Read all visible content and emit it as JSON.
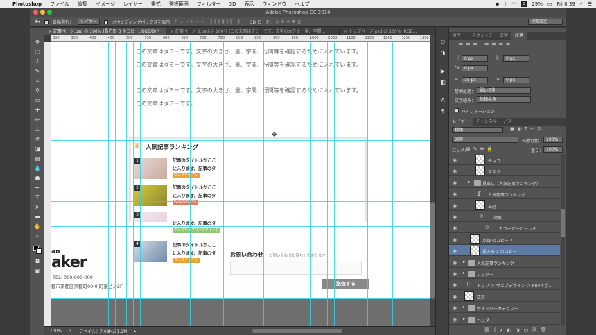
{
  "menubar": {
    "apple": "",
    "app": "Photoshop",
    "items": [
      "ファイル",
      "編集",
      "イメージ",
      "レイヤー",
      "書式",
      "選択範囲",
      "フィルター",
      "3D",
      "表示",
      "ウィンドウ",
      "ヘルプ"
    ],
    "battery": "29%",
    "badge": "A",
    "clock": "Fri 8:39"
  },
  "window": {
    "title": "Adobe Photoshop CC 2014"
  },
  "options": {
    "auto_select_label": "自動選択：",
    "auto_select_value": "レイヤー",
    "bbox_label": "バウンディングボックスを表示",
    "mode3d": "3D モード:",
    "workspace": "初期設定"
  },
  "tabs": [
    {
      "label": "記事ページ.psd @ 100% (長方形 3 のコピー, RGB/8) *",
      "active": true
    },
    {
      "label": "記事ページ 2.psd @ 100% (この文章はダミーです。文字の大きさ、量、字間…",
      "active": false
    },
    {
      "label": "トップページ.psd @ 100% (RGB…",
      "active": false
    }
  ],
  "ruler_ticks": [
    "300",
    "350",
    "400",
    "450",
    "500",
    "550",
    "600",
    "650",
    "700",
    "750",
    "800",
    "850",
    "900",
    "950",
    "1000",
    "1050",
    "1100",
    "1150",
    "1200",
    "1250",
    "1300"
  ],
  "canvas": {
    "para1": "この文章はダミーです。文字の大きさ、量、字間、行間等を確認するために入れています。この文章はダミーです。文字の大きさ、量、字間、行間等を確認するために入れています。",
    "para2": "この文章はダミーです。文字の大きさ、量、字間、行間等を確認するために入れています。この文章はダミーです。",
    "ranking_title": "人気記事ランキング",
    "ranking": [
      {
        "num": "1",
        "title": "記事のタイトルがここ",
        "title2": "に入ります。記事のタ",
        "tag": "ウェブデザイン",
        "tag_color": "#f0a030"
      },
      {
        "num": "2",
        "title": "記事のタイトルがここ",
        "title2": "に入ります。記事のタ",
        "tag": "WORDPRESS",
        "tag_color": "#e07c5a"
      },
      {
        "num": "3",
        "title": "",
        "title2": "に入ります。記事のタ",
        "tag": "ウェブウェブマーケティング",
        "tag_color": "#8cc870"
      },
      {
        "num": "4",
        "title": "記事のタイトルがここ",
        "title2": "に入ります。記事のタ",
        "tag": "ウェブデザイン",
        "tag_color": "#f0a030"
      }
    ],
    "logo_top": "an",
    "logo": "aker",
    "tel": "TEL: 000-000-000",
    "address": "都市京都区京都町00-0 町家ビル2F",
    "contact_title": "お問い合わせ",
    "contact_sub": "お問い合わせお待ちしております",
    "submit": "送信する"
  },
  "status": {
    "zoom": "100%",
    "file": "ファイル：7.08M/31.2M"
  },
  "panels": {
    "char_tabs": [
      "カラー",
      "スウォッチ",
      "文字",
      "段落"
    ],
    "char_active": "段落",
    "indent1": "0 px",
    "indent2": "0 px",
    "indent3": "0 px",
    "space1": "15 px",
    "space2": "0 px",
    "kinsoku_label": "禁則処理：",
    "kinsoku_value": "弱い禁則",
    "mojikumi_label": "文字組み：",
    "mojikumi_value": "約物半角",
    "hyphen_label": "ハイフネーション",
    "layer_tabs": [
      "レイヤー",
      "チャンネル",
      "パス"
    ],
    "layer_active": "レイヤー",
    "filter_kind": "種類",
    "blend": "通常",
    "opacity_label": "不透明度：",
    "opacity": "100%",
    "lock_label": "ロック：",
    "fill_label": "塗り：",
    "fill": "100%",
    "layers": [
      {
        "name": "チョコ",
        "kind": "pixel",
        "indent": 2,
        "selected": false
      },
      {
        "name": "マスク",
        "kind": "pixel",
        "indent": 2,
        "selected": false
      },
      {
        "name": "見出し（人気記事ランキング）",
        "kind": "group",
        "indent": 1,
        "selected": false
      },
      {
        "name": "人気記事ランキング",
        "kind": "text",
        "indent": 2,
        "selected": false
      },
      {
        "name": "王冠",
        "kind": "pixel",
        "indent": 2,
        "selected": false
      },
      {
        "name": "効果",
        "kind": "fx",
        "indent": 3,
        "selected": false
      },
      {
        "name": "カラーオーバーレイ",
        "kind": "fx",
        "indent": 4,
        "selected": false
      },
      {
        "name": "点線 のコピー 7",
        "kind": "pixel",
        "indent": 1,
        "selected": false
      },
      {
        "name": "長方形 3 のコピー",
        "kind": "pixel",
        "indent": 1,
        "selected": true
      },
      {
        "name": "人気記事ランキング",
        "kind": "group",
        "indent": 0,
        "selected": false
      },
      {
        "name": "フッター",
        "kind": "group",
        "indent": 0,
        "selected": false
      },
      {
        "name": "トップ ＞ ウェブデザイン ＞ PHPで学…",
        "kind": "text",
        "indent": 0,
        "selected": false
      },
      {
        "name": "広告",
        "kind": "pixel",
        "indent": 0,
        "selected": false
      },
      {
        "name": "サイドバーカテゴリー",
        "kind": "group",
        "indent": 0,
        "selected": false
      },
      {
        "name": "ヘッダー",
        "kind": "group",
        "indent": 0,
        "selected": false
      }
    ]
  },
  "colors": {
    "guide": "#2fd2e6",
    "selection": "#5d7aa3",
    "panel": "#535353"
  }
}
